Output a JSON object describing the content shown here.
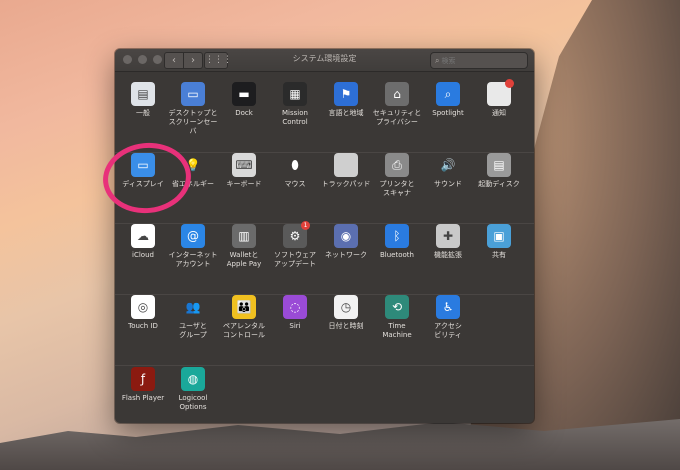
{
  "window": {
    "title": "システム環境設定",
    "search_placeholder": "検索",
    "nav_back": "‹",
    "nav_forward": "›",
    "grid": "⋮⋮⋮"
  },
  "rows": [
    [
      {
        "name": "general",
        "label": "一般",
        "color": "#dfe3e8",
        "glyph": "▤",
        "icon": "file-icon"
      },
      {
        "name": "desktop-screensaver",
        "label": "デスクトップと\nスクリーンセーバ",
        "color": "#4a7fd6",
        "glyph": "▭",
        "icon": "desktop-icon"
      },
      {
        "name": "dock",
        "label": "Dock",
        "color": "#1d1d1f",
        "glyph": "▬",
        "icon": "dock-icon"
      },
      {
        "name": "mission-control",
        "label": "Mission\nControl",
        "color": "#2b2b2b",
        "glyph": "▦",
        "icon": "mission-control-icon"
      },
      {
        "name": "language-region",
        "label": "言語と地域",
        "color": "#2d6fd6",
        "glyph": "⚑",
        "icon": "flag-icon"
      },
      {
        "name": "security-privacy",
        "label": "セキュリティと\nプライバシー",
        "color": "#6d6d6d",
        "glyph": "⌂",
        "icon": "house-icon"
      },
      {
        "name": "spotlight",
        "label": "Spotlight",
        "color": "#2a7be0",
        "glyph": "⌕",
        "icon": "magnifier-icon"
      },
      {
        "name": "notifications",
        "label": "通知",
        "color": "#e9e9e9",
        "glyph": "",
        "icon": "notifications-icon",
        "badge": true
      }
    ],
    [
      {
        "name": "displays",
        "label": "ディスプレイ",
        "color": "#3a8ee8",
        "glyph": "▭",
        "icon": "monitor-icon"
      },
      {
        "name": "energy-saver",
        "label": "省エネルギー",
        "color": "transparent",
        "glyph": "💡",
        "icon": "bulb-icon"
      },
      {
        "name": "keyboard",
        "label": "キーボード",
        "color": "#d9d9d9",
        "glyph": "⌨",
        "icon": "keyboard-icon"
      },
      {
        "name": "mouse",
        "label": "マウス",
        "color": "transparent",
        "glyph": "⬮",
        "icon": "mouse-icon"
      },
      {
        "name": "trackpad",
        "label": "トラックパッド",
        "color": "#cfcfcf",
        "glyph": "",
        "icon": "trackpad-icon"
      },
      {
        "name": "printers-scanners",
        "label": "プリンタと\nスキャナ",
        "color": "#8a8a8a",
        "glyph": "⎙",
        "icon": "printer-icon"
      },
      {
        "name": "sound",
        "label": "サウンド",
        "color": "transparent",
        "glyph": "🔊",
        "icon": "speaker-icon"
      },
      {
        "name": "startup-disk",
        "label": "起動ディスク",
        "color": "#9a9a9a",
        "glyph": "▤",
        "icon": "disk-icon"
      }
    ],
    [
      {
        "name": "icloud",
        "label": "iCloud",
        "color": "#ffffff",
        "glyph": "☁",
        "icon": "cloud-icon"
      },
      {
        "name": "internet-accounts",
        "label": "インターネット\nアカウント",
        "color": "#2b86e6",
        "glyph": "@",
        "icon": "at-icon"
      },
      {
        "name": "wallet-applepay",
        "label": "Walletと\nApple Pay",
        "color": "#6b6b6b",
        "glyph": "▥",
        "icon": "wallet-icon"
      },
      {
        "name": "software-update",
        "label": "ソフトウェア\nアップデート",
        "color": "#5a5a5a",
        "glyph": "⚙",
        "icon": "gear-icon",
        "badge": true,
        "badge_text": "1"
      },
      {
        "name": "network",
        "label": "ネットワーク",
        "color": "#5b6fb0",
        "glyph": "◉",
        "icon": "globe-icon"
      },
      {
        "name": "bluetooth",
        "label": "Bluetooth",
        "color": "#2a7be0",
        "glyph": "ᛒ",
        "icon": "bluetooth-icon"
      },
      {
        "name": "extensions",
        "label": "機能拡張",
        "color": "#c9c9c9",
        "glyph": "✚",
        "icon": "puzzle-icon"
      },
      {
        "name": "sharing",
        "label": "共有",
        "color": "#4aa0d8",
        "glyph": "▣",
        "icon": "folder-icon"
      }
    ],
    [
      {
        "name": "touch-id",
        "label": "Touch ID",
        "color": "#ffffff",
        "glyph": "◎",
        "icon": "fingerprint-icon"
      },
      {
        "name": "users-groups",
        "label": "ユーザと\nグループ",
        "color": "transparent",
        "glyph": "👥",
        "icon": "users-icon"
      },
      {
        "name": "parental-controls",
        "label": "ペアレンタル\nコントロール",
        "color": "#f0c020",
        "glyph": "👪",
        "icon": "parental-icon"
      },
      {
        "name": "siri",
        "label": "Siri",
        "color": "#9a4bd6",
        "glyph": "◌",
        "icon": "siri-icon"
      },
      {
        "name": "date-time",
        "label": "日付と時刻",
        "color": "#f2f2f2",
        "glyph": "◷",
        "icon": "clock-icon"
      },
      {
        "name": "time-machine",
        "label": "Time\nMachine",
        "color": "#2e8a7a",
        "glyph": "⟲",
        "icon": "time-machine-icon"
      },
      {
        "name": "accessibility",
        "label": "アクセシ\nビリティ",
        "color": "#2a7be0",
        "glyph": "♿",
        "icon": "accessibility-icon"
      }
    ],
    [
      {
        "name": "flash-player",
        "label": "Flash Player",
        "color": "#8b1a10",
        "glyph": "ƒ",
        "icon": "flash-icon"
      },
      {
        "name": "logicool-options",
        "label": "Logicool Options",
        "color": "#1aa89a",
        "glyph": "◍",
        "icon": "logicool-icon"
      }
    ]
  ]
}
